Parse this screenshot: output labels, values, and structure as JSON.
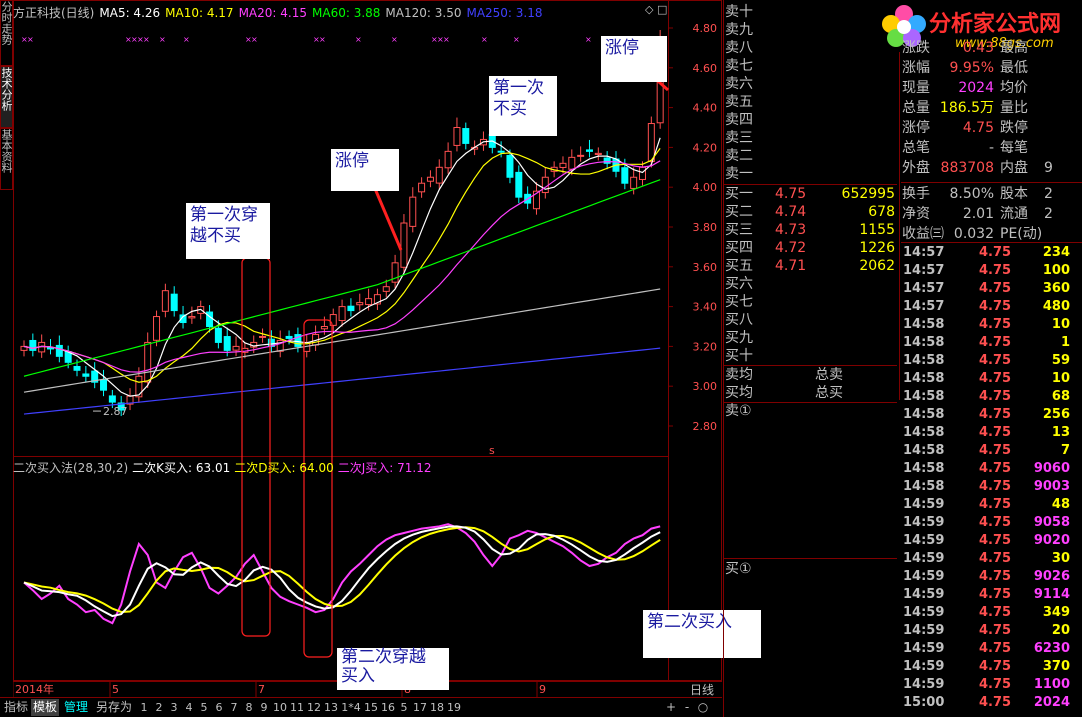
{
  "side_tabs": [
    "分时走势",
    "技术分析",
    "基本资料"
  ],
  "ma_legend": [
    {
      "label": "方正科技(日线)",
      "color": "#c0c0c0"
    },
    {
      "label": "MA5: 4.26",
      "color": "#ffffff"
    },
    {
      "label": "MA10: 4.17",
      "color": "#ffff00"
    },
    {
      "label": "MA20: 4.15",
      "color": "#ff40ff"
    },
    {
      "label": "MA60: 3.88",
      "color": "#00ff00"
    },
    {
      "label": "MA120: 3.50",
      "color": "#c0c0c0"
    },
    {
      "label": "MA250: 3.18",
      "color": "#4040ff"
    }
  ],
  "kdj_legend": [
    {
      "label": "二次买入法(28,30,2)",
      "color": "#c0c0c0"
    },
    {
      "label": "二次K买入: 63.01",
      "color": "#ffffff"
    },
    {
      "label": "二次D买入: 64.00",
      "color": "#ffff00"
    },
    {
      "label": "二次J买入: 71.12",
      "color": "#ff40ff"
    }
  ],
  "y_axis_labels": [
    "4.80",
    "4.60",
    "4.40",
    "4.20",
    "4.00",
    "3.80",
    "3.60",
    "3.40",
    "3.20",
    "3.00",
    "2.80"
  ],
  "low_marker": "2.87",
  "x_axis_labels": [
    {
      "label": "2014年",
      "color": "#ff5050"
    },
    {
      "label": "5",
      "color": "#ff5050"
    },
    {
      "label": "7",
      "color": "#ff5050"
    },
    {
      "label": "8",
      "color": "#ff5050"
    },
    {
      "label": "9",
      "color": "#ff5050"
    }
  ],
  "period_label": "日线",
  "annotations": [
    {
      "text": "涨停"
    },
    {
      "text": "第一次\n不买"
    },
    {
      "text": "涨停"
    },
    {
      "text": "第一次穿\n越不买"
    },
    {
      "text": "第二次买入"
    },
    {
      "text": "第二次穿越\n买入"
    }
  ],
  "toolbar": {
    "tabs": [
      "指标",
      "模板",
      "管理",
      "另存为"
    ],
    "numbers": [
      "1",
      "2",
      "3",
      "4",
      "5",
      "6",
      "7",
      "8",
      "9",
      "10",
      "11",
      "12",
      "13",
      "1*4",
      "15",
      "16",
      "5",
      "17",
      "18",
      "19"
    ],
    "controls": [
      "+",
      "-",
      "○"
    ]
  },
  "order_book": {
    "sell": [
      {
        "name": "卖十",
        "price": "",
        "vol": ""
      },
      {
        "name": "卖九",
        "price": "",
        "vol": ""
      },
      {
        "name": "卖八",
        "price": "",
        "vol": ""
      },
      {
        "name": "卖七",
        "price": "",
        "vol": ""
      },
      {
        "name": "卖六",
        "price": "",
        "vol": ""
      },
      {
        "name": "卖五",
        "price": "",
        "vol": ""
      },
      {
        "name": "卖四",
        "price": "",
        "vol": ""
      },
      {
        "name": "卖三",
        "price": "",
        "vol": ""
      },
      {
        "name": "卖二",
        "price": "",
        "vol": ""
      },
      {
        "name": "卖一",
        "price": "",
        "vol": ""
      }
    ],
    "buy": [
      {
        "name": "买一",
        "price": "4.75",
        "vol": "652995"
      },
      {
        "name": "买二",
        "price": "4.74",
        "vol": "678"
      },
      {
        "name": "买三",
        "price": "4.73",
        "vol": "1155"
      },
      {
        "name": "买四",
        "price": "4.72",
        "vol": "1226"
      },
      {
        "name": "买五",
        "price": "4.71",
        "vol": "2062"
      },
      {
        "name": "买六",
        "price": "",
        "vol": ""
      },
      {
        "name": "买七",
        "price": "",
        "vol": ""
      },
      {
        "name": "买八",
        "price": "",
        "vol": ""
      },
      {
        "name": "买九",
        "price": "",
        "vol": ""
      },
      {
        "name": "买十",
        "price": "",
        "vol": ""
      }
    ],
    "sell_avg": "卖均",
    "buy_avg": "买均",
    "total_sell": "总卖",
    "total_buy": "总买",
    "sell_marker": "卖①",
    "buy_marker": "买①"
  },
  "logo": {
    "text": "分析家公式网",
    "url": "www.88gs.com"
  },
  "stats": [
    {
      "l": "涨跌",
      "v": "0.43",
      "vc": "#ff5050",
      "l2": "最高",
      "v2": ""
    },
    {
      "l": "涨幅",
      "v": "9.95%",
      "vc": "#ff5050",
      "l2": "最低",
      "v2": ""
    },
    {
      "l": "现量",
      "v": "2024",
      "vc": "#ff40ff",
      "l2": "均价",
      "v2": ""
    },
    {
      "l": "总量",
      "v": "186.5万",
      "vc": "#ffff00",
      "l2": "量比",
      "v2": ""
    },
    {
      "l": "涨停",
      "v": "4.75",
      "vc": "#ff5050",
      "l2": "跌停",
      "v2": ""
    },
    {
      "l": "总笔",
      "v": "-",
      "vc": "#c0c0c0",
      "l2": "每笔",
      "v2": ""
    },
    {
      "l": "外盘",
      "v": "883708",
      "vc": "#ff5050",
      "l2": "内盘",
      "v2": "9"
    }
  ],
  "stats2": [
    {
      "l": "换手",
      "v": "8.50%",
      "vc": "#c0c0c0",
      "l2": "股本",
      "v2": "2"
    },
    {
      "l": "净资",
      "v": "2.01",
      "vc": "#c0c0c0",
      "l2": "流通",
      "v2": "2"
    },
    {
      "l": "收益㈢",
      "v": "0.032",
      "vc": "#c0c0c0",
      "l2": "PE(动)",
      "v2": ""
    }
  ],
  "ticks": [
    {
      "t": "14:57",
      "p": "4.75",
      "v": "234",
      "c": "#ffff00"
    },
    {
      "t": "14:57",
      "p": "4.75",
      "v": "100",
      "c": "#ffff00"
    },
    {
      "t": "14:57",
      "p": "4.75",
      "v": "360",
      "c": "#ffff00"
    },
    {
      "t": "14:57",
      "p": "4.75",
      "v": "480",
      "c": "#ffff00"
    },
    {
      "t": "14:58",
      "p": "4.75",
      "v": "10",
      "c": "#ffff00"
    },
    {
      "t": "14:58",
      "p": "4.75",
      "v": "1",
      "c": "#ffff00"
    },
    {
      "t": "14:58",
      "p": "4.75",
      "v": "59",
      "c": "#ffff00"
    },
    {
      "t": "14:58",
      "p": "4.75",
      "v": "10",
      "c": "#ffff00"
    },
    {
      "t": "14:58",
      "p": "4.75",
      "v": "68",
      "c": "#ffff00"
    },
    {
      "t": "14:58",
      "p": "4.75",
      "v": "256",
      "c": "#ffff00"
    },
    {
      "t": "14:58",
      "p": "4.75",
      "v": "13",
      "c": "#ffff00"
    },
    {
      "t": "14:58",
      "p": "4.75",
      "v": "7",
      "c": "#ffff00"
    },
    {
      "t": "14:58",
      "p": "4.75",
      "v": "9060",
      "c": "#ff40ff"
    },
    {
      "t": "14:58",
      "p": "4.75",
      "v": "9003",
      "c": "#ff40ff"
    },
    {
      "t": "14:59",
      "p": "4.75",
      "v": "48",
      "c": "#ffff00"
    },
    {
      "t": "14:59",
      "p": "4.75",
      "v": "9058",
      "c": "#ff40ff"
    },
    {
      "t": "14:59",
      "p": "4.75",
      "v": "9020",
      "c": "#ff40ff"
    },
    {
      "t": "14:59",
      "p": "4.75",
      "v": "30",
      "c": "#ffff00"
    },
    {
      "t": "14:59",
      "p": "4.75",
      "v": "9026",
      "c": "#ff40ff"
    },
    {
      "t": "14:59",
      "p": "4.75",
      "v": "9114",
      "c": "#ff40ff"
    },
    {
      "t": "14:59",
      "p": "4.75",
      "v": "349",
      "c": "#ffff00"
    },
    {
      "t": "14:59",
      "p": "4.75",
      "v": "20",
      "c": "#ffff00"
    },
    {
      "t": "14:59",
      "p": "4.75",
      "v": "6230",
      "c": "#ff40ff"
    },
    {
      "t": "14:59",
      "p": "4.75",
      "v": "370",
      "c": "#ffff00"
    },
    {
      "t": "14:59",
      "p": "4.75",
      "v": "1100",
      "c": "#ff40ff"
    },
    {
      "t": "15:00",
      "p": "4.75",
      "v": "2024",
      "c": "#ff40ff"
    }
  ],
  "colors": {
    "up": "#ff5050",
    "down": "#00ffff",
    "frame": "#7f0000"
  }
}
